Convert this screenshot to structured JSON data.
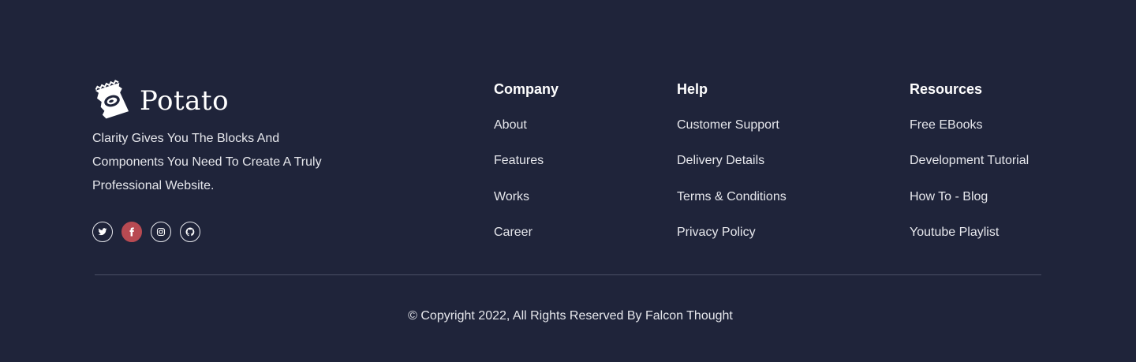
{
  "brand": {
    "name": "Potato",
    "tagline": "Clarity Gives You The Blocks And Components You Need To Create A Truly Professional Website."
  },
  "socials": [
    {
      "icon": "twitter-icon",
      "active": false
    },
    {
      "icon": "facebook-icon",
      "active": true
    },
    {
      "icon": "instagram-icon",
      "active": false
    },
    {
      "icon": "github-icon",
      "active": false
    }
  ],
  "columns": {
    "company": {
      "heading": "Company",
      "links": [
        "About",
        "Features",
        "Works",
        "Career"
      ]
    },
    "help": {
      "heading": "Help",
      "links": [
        "Customer Support",
        "Delivery Details",
        "Terms & Conditions",
        "Privacy Policy"
      ]
    },
    "resources": {
      "heading": "Resources",
      "links": [
        "Free EBooks",
        "Development Tutorial",
        "How To - Blog",
        "Youtube Playlist"
      ]
    }
  },
  "copyright": "© Copyright 2022, All Rights Reserved By Falcon Thought",
  "colors": {
    "background": "#1f243a",
    "accent": "#b84a52",
    "text": "#e6e7ec",
    "divider": "#4a4f66"
  }
}
